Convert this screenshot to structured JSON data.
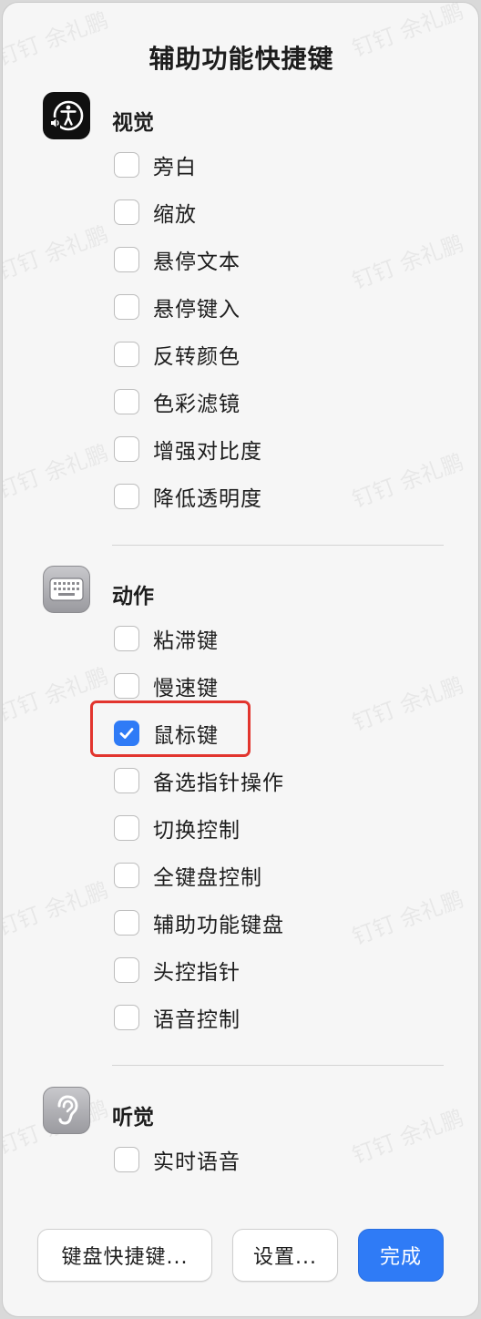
{
  "dialog": {
    "title": "辅助功能快捷键"
  },
  "sections": [
    {
      "title": "视觉",
      "icon": "accessibility-person-icon",
      "items": [
        {
          "label": "旁白",
          "checked": false
        },
        {
          "label": "缩放",
          "checked": false
        },
        {
          "label": "悬停文本",
          "checked": false
        },
        {
          "label": "悬停键入",
          "checked": false
        },
        {
          "label": "反转颜色",
          "checked": false
        },
        {
          "label": "色彩滤镜",
          "checked": false
        },
        {
          "label": "增强对比度",
          "checked": false
        },
        {
          "label": "降低透明度",
          "checked": false
        }
      ]
    },
    {
      "title": "动作",
      "icon": "keyboard-icon",
      "items": [
        {
          "label": "粘滞键",
          "checked": false
        },
        {
          "label": "慢速键",
          "checked": false
        },
        {
          "label": "鼠标键",
          "checked": true
        },
        {
          "label": "备选指针操作",
          "checked": false
        },
        {
          "label": "切换控制",
          "checked": false
        },
        {
          "label": "全键盘控制",
          "checked": false
        },
        {
          "label": "辅助功能键盘",
          "checked": false
        },
        {
          "label": "头控指针",
          "checked": false
        },
        {
          "label": "语音控制",
          "checked": false
        }
      ]
    },
    {
      "title": "听觉",
      "icon": "ear-icon",
      "items": [
        {
          "label": "实时语音",
          "checked": false
        }
      ]
    }
  ],
  "buttons": {
    "keyboard_shortcuts": "键盘快捷键...",
    "settings": "设置...",
    "done": "完成"
  },
  "watermark": {
    "text": "钉钉 余礼鹏"
  },
  "colors": {
    "accent": "#2f7bf6",
    "highlight": "#e2352e"
  }
}
